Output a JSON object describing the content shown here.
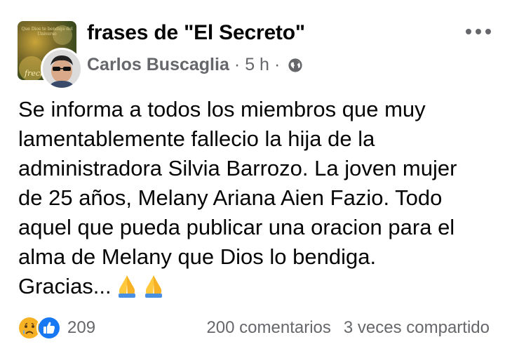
{
  "post": {
    "group_name": "frases de \"El Secreto\"",
    "author": "Carlos Buscaglia",
    "time": "5 h",
    "separator": "·",
    "privacy_icon": "globe-icon",
    "more_icon": "more-options-icon",
    "lines": [
      "Se informa a todos los miembros que muy",
      "lamentablemente fallecio la hija de la",
      "administradora Silvia Barrozo. La joven mujer",
      "de 25 años, Melany Ariana Aien Fazio. Todo",
      "aquel que pueda publicar una oracion para el",
      "alma de Melany que Dios lo bendiga.",
      "Gracias..."
    ],
    "emoji": "🙏🙏",
    "avatar_caption": "Que Dios te bendiga del Universo",
    "avatar_signature": "frech"
  },
  "footer": {
    "reaction_icons": [
      "sad-reaction-icon",
      "like-reaction-icon"
    ],
    "reaction_count": "209",
    "comments": "200 comentarios",
    "shares": "3 veces compartido"
  },
  "colors": {
    "text": "#050505",
    "secondary": "#65676b",
    "like_blue": "#1877f2",
    "sad_yellow": "#f7b125"
  }
}
